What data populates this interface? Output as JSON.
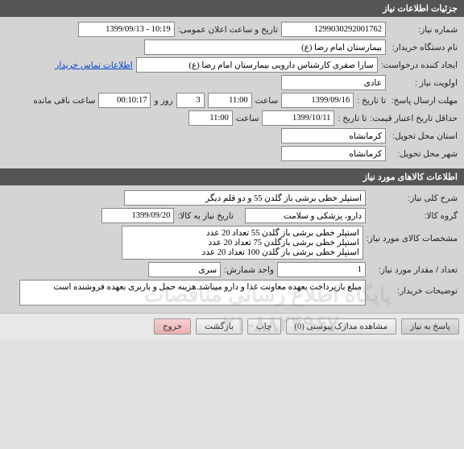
{
  "header1": "جزئیات اطلاعات نیاز",
  "header2": "اطلاعات کالاهای مورد نیاز",
  "row1": {
    "label_num": "شماره نیاز:",
    "num": "1299030292001762",
    "label_datetime": "تاریخ و ساعت اعلان عمومی:",
    "datetime": "10:19 - 1399/09/13"
  },
  "row2": {
    "label_org": "نام دستگاه خریدار:",
    "org": "بیمارستان امام رضا (ع)"
  },
  "row3": {
    "label_creator": "ایجاد کننده درخواست:",
    "creator": "سارا صفری کارشناس دارویی بیمارستان امام رضا (ع)",
    "contact_link": "اطلاعات تماس خریدار"
  },
  "row4": {
    "label_priority": "اولویت نیاز :",
    "priority": "عادی"
  },
  "row5": {
    "label_deadline": "مهلت ارسال پاسخ:",
    "label_todate": "تا تاریخ :",
    "date": "1399/09/16",
    "label_time": "ساعت",
    "time": "11:00",
    "days": "3",
    "label_days": "روز و",
    "countdown": "00:10:17",
    "label_remain": "ساعت باقی مانده"
  },
  "row6": {
    "label_min": "حداقل تاریخ اعتبار قیمت:",
    "label_todate": "تا تاریخ :",
    "date": "1399/10/11",
    "label_time": "ساعت",
    "time": "11:00"
  },
  "row7": {
    "label_province": "استان محل تحویل:",
    "province": "کرمانشاه"
  },
  "row8": {
    "label_city": "شهر محل تحویل:",
    "city": "کرمانشاه"
  },
  "goods": {
    "label_desc": "شرح کلی نیاز:",
    "desc": "استپلر خطی برشی باز گلدن 55 و دو قلم دیگر",
    "label_group": "گروه کالا:",
    "group": "دارو، پزشکی و سلامت",
    "label_needdate": "تاریخ نیاز به کالا:",
    "needdate": "1399/09/20",
    "label_spec": "مشخصات کالای مورد نیاز:",
    "spec": "استپلر خطی برشی باز گلدن 55 تعداد 20 عدد\nاستپلر خطی برشی بازگلدن 75 تعداد 20 عدد\nاستپلر خطی برشی باز گلدن 100 تعداد 20 عدد",
    "label_qty": "تعداد / مقدار مورد نیاز:",
    "qty": "1",
    "label_unit": "واحد شمارش:",
    "unit": "سری",
    "label_notes": "توضیحات خریدار:",
    "notes": "مبلغ بازپرداخت بعهده معاونت غذا و دارو میباشد.هزینه حمل و باربری بعهده فروشنده است"
  },
  "footer": {
    "respond": "پاسخ به نیاز",
    "attachments": "مشاهده مدارک پیوستی  (0)",
    "print": "چاپ",
    "back": "بازگشت",
    "exit": "خروج"
  },
  "watermark1": "پایگاه اطلاع رسانی مناقصات",
  "watermark2": "۰۲۱-۸۸۲۴۹۶۷۰"
}
